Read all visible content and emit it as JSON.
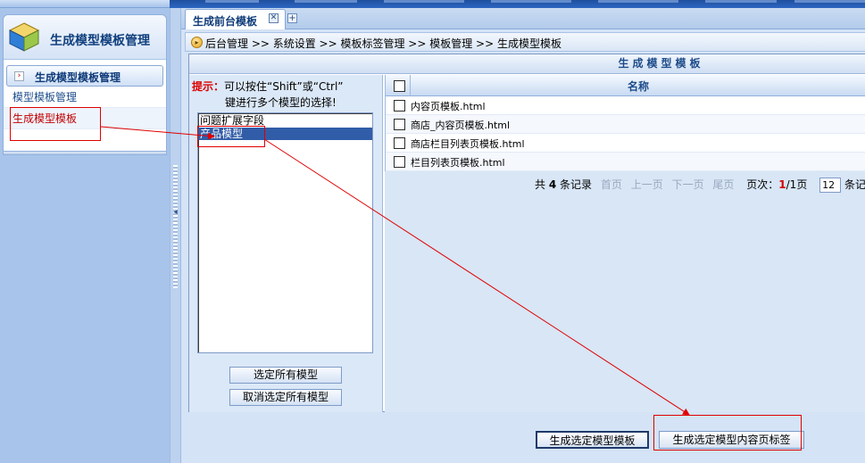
{
  "sidebar": {
    "title": "生成模型模板管理",
    "group_label": "生成模型模板管理",
    "items": [
      {
        "label": "模型模板管理",
        "active": false
      },
      {
        "label": "生成模型模板",
        "active": true
      }
    ]
  },
  "tabs": [
    {
      "label": "生成前台模板",
      "close": "✕"
    }
  ],
  "tab_add": "+",
  "breadcrumb": "后台管理 >> 系统设置 >> 模板标签管理 >> 模板管理 >> 生成模型模板",
  "panel_title": "生成模型模板",
  "hint": {
    "tag": "提示：",
    "line1": "可以按住“Shift”或“Ctrl”",
    "line2": "键进行多个模型的选择!"
  },
  "models": [
    {
      "label": "问题扩展字段",
      "selected": false
    },
    {
      "label": "产品模型",
      "selected": true
    }
  ],
  "select_all_label": "选定所有模型",
  "deselect_all_label": "取消选定所有模型",
  "grid": {
    "column_name": "名称",
    "rows": [
      {
        "name": "内容页模板.html"
      },
      {
        "name": "商店_内容页模板.html"
      },
      {
        "name": "商店栏目列表页模板.html"
      },
      {
        "name": "栏目列表页模板.html"
      }
    ]
  },
  "pager": {
    "total_prefix": "共",
    "total_count": "4",
    "total_suffix": "条记录",
    "first": "首页",
    "prev": "上一页",
    "next": "下一页",
    "last": "尾页",
    "page_label": "页次：",
    "page_current": "1",
    "page_total": "/1页",
    "page_size": "12",
    "page_size_suffix": "条记"
  },
  "actions": {
    "generate_template": "生成选定模型模板",
    "generate_tag": "生成选定模型内容页标签"
  },
  "colors": {
    "annotation": "#e00000",
    "accent": "#1d4c8a"
  }
}
